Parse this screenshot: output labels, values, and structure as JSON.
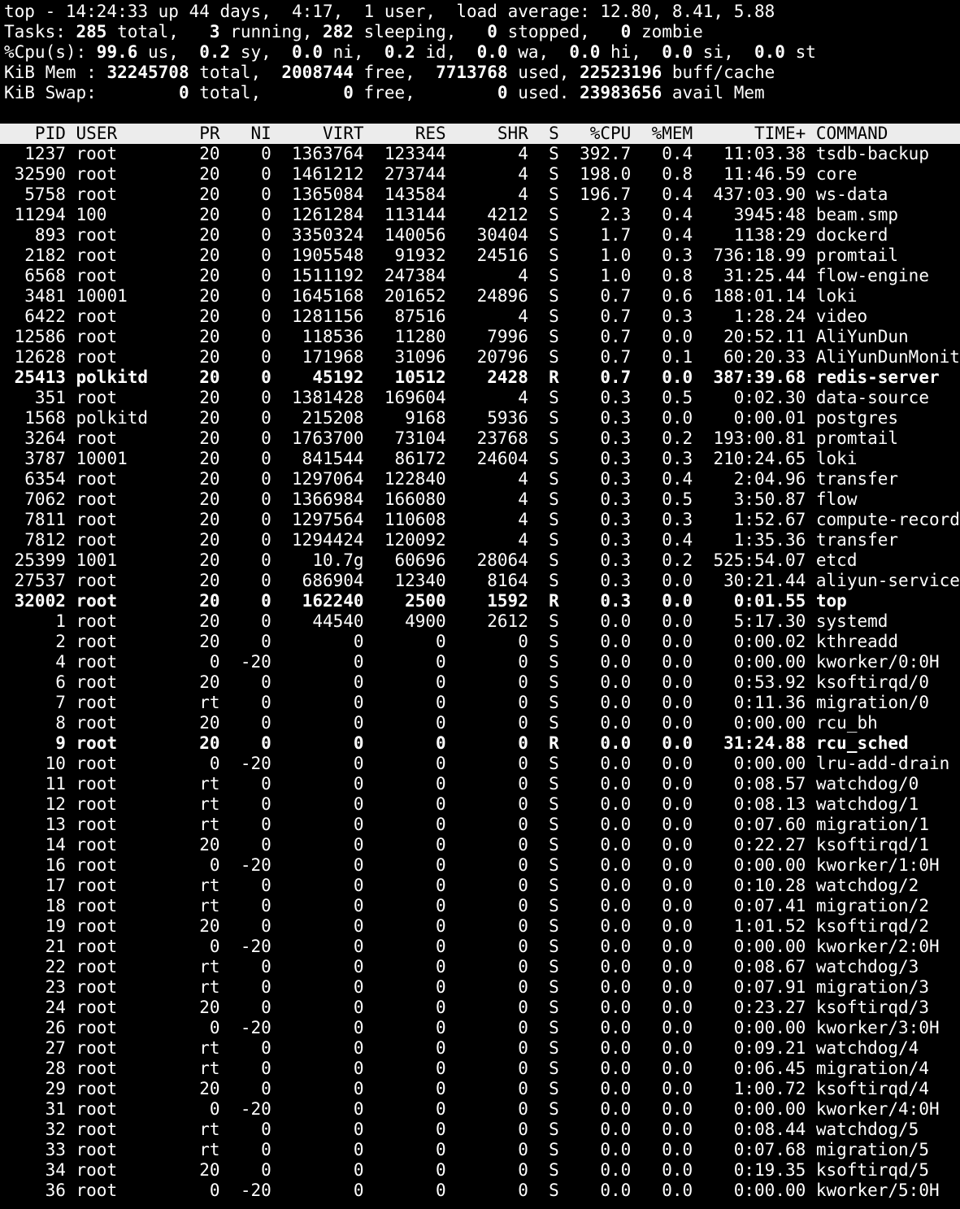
{
  "summary": {
    "top": {
      "prefix": "top - ",
      "time": "14:24:33",
      "up_label": " up ",
      "uptime": "44 days,  4:17",
      "users_sep": ",  ",
      "users": "1",
      "users_label": " user,  load average: ",
      "load": "12.80, 8.41, 5.88"
    },
    "tasks": {
      "label": "Tasks: ",
      "total": "285",
      "total_label": " total,   ",
      "running": "3",
      "running_label": " running, ",
      "sleeping": "282",
      "sleeping_label": " sleeping,   ",
      "stopped": "0",
      "stopped_label": " stopped,   ",
      "zombie": "0",
      "zombie_label": " zombie"
    },
    "cpu": {
      "label": "%Cpu(s): ",
      "us": "99.6",
      "us_label": " us,  ",
      "sy": "0.2",
      "sy_label": " sy,  ",
      "ni": "0.0",
      "ni_label": " ni,  ",
      "id": "0.2",
      "id_label": " id,  ",
      "wa": "0.0",
      "wa_label": " wa,  ",
      "hi": "0.0",
      "hi_label": " hi,  ",
      "si": "0.0",
      "si_label": " si,  ",
      "st": "0.0",
      "st_label": " st"
    },
    "mem": {
      "label": "KiB Mem : ",
      "total": "32245708",
      "total_label": " total,  ",
      "free": "2008744",
      "free_label": " free,  ",
      "used": "7713768",
      "used_label": " used, ",
      "buff": "22523196",
      "buff_label": " buff/cache"
    },
    "swap": {
      "label": "KiB Swap:        ",
      "total": "0",
      "total_label": " total,        ",
      "free": "0",
      "free_label": " free,        ",
      "used": "0",
      "used_label": " used. ",
      "avail": "23983656",
      "avail_label": " avail Mem"
    }
  },
  "columns": [
    {
      "key": "pid",
      "label": "PID",
      "width": 6,
      "align": "right"
    },
    {
      "key": "user",
      "label": "USER",
      "width": 9,
      "align": "left"
    },
    {
      "key": "pr",
      "label": "PR",
      "width": 4,
      "align": "right"
    },
    {
      "key": "ni",
      "label": "NI",
      "width": 4,
      "align": "right"
    },
    {
      "key": "virt",
      "label": "VIRT",
      "width": 8,
      "align": "right"
    },
    {
      "key": "res",
      "label": "RES",
      "width": 7,
      "align": "right"
    },
    {
      "key": "shr",
      "label": "SHR",
      "width": 7,
      "align": "right"
    },
    {
      "key": "s",
      "label": "S",
      "width": 2,
      "align": "right"
    },
    {
      "key": "cpu",
      "label": "%CPU",
      "width": 6,
      "align": "right"
    },
    {
      "key": "mem",
      "label": "%MEM",
      "width": 5,
      "align": "right"
    },
    {
      "key": "time",
      "label": "TIME+",
      "width": 10,
      "align": "right"
    },
    {
      "key": "command",
      "label": "COMMAND",
      "width": 0,
      "align": "left"
    }
  ],
  "processes": [
    [
      "1237",
      "root",
      "20",
      "0",
      "1363764",
      "123344",
      "4",
      "S",
      "392.7",
      "0.4",
      "11:03.38",
      "tsdb-backup"
    ],
    [
      "32590",
      "root",
      "20",
      "0",
      "1461212",
      "273744",
      "4",
      "S",
      "198.0",
      "0.8",
      "11:46.59",
      "core"
    ],
    [
      "5758",
      "root",
      "20",
      "0",
      "1365084",
      "143584",
      "4",
      "S",
      "196.7",
      "0.4",
      "437:03.90",
      "ws-data"
    ],
    [
      "11294",
      "100",
      "20",
      "0",
      "1261284",
      "113144",
      "4212",
      "S",
      "2.3",
      "0.4",
      "3945:48",
      "beam.smp"
    ],
    [
      "893",
      "root",
      "20",
      "0",
      "3350324",
      "140056",
      "30404",
      "S",
      "1.7",
      "0.4",
      "1138:29",
      "dockerd"
    ],
    [
      "2182",
      "root",
      "20",
      "0",
      "1905548",
      "91932",
      "24516",
      "S",
      "1.0",
      "0.3",
      "736:18.99",
      "promtail"
    ],
    [
      "6568",
      "root",
      "20",
      "0",
      "1511192",
      "247384",
      "4",
      "S",
      "1.0",
      "0.8",
      "31:25.44",
      "flow-engine"
    ],
    [
      "3481",
      "10001",
      "20",
      "0",
      "1645168",
      "201652",
      "24896",
      "S",
      "0.7",
      "0.6",
      "188:01.14",
      "loki"
    ],
    [
      "6422",
      "root",
      "20",
      "0",
      "1281156",
      "87516",
      "4",
      "S",
      "0.7",
      "0.3",
      "1:28.24",
      "video"
    ],
    [
      "12586",
      "root",
      "20",
      "0",
      "118536",
      "11280",
      "7996",
      "S",
      "0.7",
      "0.0",
      "20:52.11",
      "AliYunDun"
    ],
    [
      "12628",
      "root",
      "20",
      "0",
      "171968",
      "31096",
      "20796",
      "S",
      "0.7",
      "0.1",
      "60:20.33",
      "AliYunDunMonito"
    ],
    [
      "25413",
      "polkitd",
      "20",
      "0",
      "45192",
      "10512",
      "2428",
      "R",
      "0.7",
      "0.0",
      "387:39.68",
      "redis-server"
    ],
    [
      "351",
      "root",
      "20",
      "0",
      "1381428",
      "169604",
      "4",
      "S",
      "0.3",
      "0.5",
      "0:02.30",
      "data-source"
    ],
    [
      "1568",
      "polkitd",
      "20",
      "0",
      "215208",
      "9168",
      "5936",
      "S",
      "0.3",
      "0.0",
      "0:00.01",
      "postgres"
    ],
    [
      "3264",
      "root",
      "20",
      "0",
      "1763700",
      "73104",
      "23768",
      "S",
      "0.3",
      "0.2",
      "193:00.81",
      "promtail"
    ],
    [
      "3787",
      "10001",
      "20",
      "0",
      "841544",
      "86172",
      "24604",
      "S",
      "0.3",
      "0.3",
      "210:24.65",
      "loki"
    ],
    [
      "6354",
      "root",
      "20",
      "0",
      "1297064",
      "122840",
      "4",
      "S",
      "0.3",
      "0.4",
      "2:04.96",
      "transfer"
    ],
    [
      "7062",
      "root",
      "20",
      "0",
      "1366984",
      "166080",
      "4",
      "S",
      "0.3",
      "0.5",
      "3:50.87",
      "flow"
    ],
    [
      "7811",
      "root",
      "20",
      "0",
      "1297564",
      "110608",
      "4",
      "S",
      "0.3",
      "0.3",
      "1:52.67",
      "compute-record"
    ],
    [
      "7812",
      "root",
      "20",
      "0",
      "1294424",
      "120092",
      "4",
      "S",
      "0.3",
      "0.4",
      "1:35.36",
      "transfer"
    ],
    [
      "25399",
      "1001",
      "20",
      "0",
      "10.7g",
      "60696",
      "28064",
      "S",
      "0.3",
      "0.2",
      "525:54.07",
      "etcd"
    ],
    [
      "27537",
      "root",
      "20",
      "0",
      "686904",
      "12340",
      "8164",
      "S",
      "0.3",
      "0.0",
      "30:21.44",
      "aliyun-service"
    ],
    [
      "32002",
      "root",
      "20",
      "0",
      "162240",
      "2500",
      "1592",
      "R",
      "0.3",
      "0.0",
      "0:01.55",
      "top"
    ],
    [
      "1",
      "root",
      "20",
      "0",
      "44540",
      "4900",
      "2612",
      "S",
      "0.0",
      "0.0",
      "5:17.30",
      "systemd"
    ],
    [
      "2",
      "root",
      "20",
      "0",
      "0",
      "0",
      "0",
      "S",
      "0.0",
      "0.0",
      "0:00.02",
      "kthreadd"
    ],
    [
      "4",
      "root",
      "0",
      "-20",
      "0",
      "0",
      "0",
      "S",
      "0.0",
      "0.0",
      "0:00.00",
      "kworker/0:0H"
    ],
    [
      "6",
      "root",
      "20",
      "0",
      "0",
      "0",
      "0",
      "S",
      "0.0",
      "0.0",
      "0:53.92",
      "ksoftirqd/0"
    ],
    [
      "7",
      "root",
      "rt",
      "0",
      "0",
      "0",
      "0",
      "S",
      "0.0",
      "0.0",
      "0:11.36",
      "migration/0"
    ],
    [
      "8",
      "root",
      "20",
      "0",
      "0",
      "0",
      "0",
      "S",
      "0.0",
      "0.0",
      "0:00.00",
      "rcu_bh"
    ],
    [
      "9",
      "root",
      "20",
      "0",
      "0",
      "0",
      "0",
      "R",
      "0.0",
      "0.0",
      "31:24.88",
      "rcu_sched"
    ],
    [
      "10",
      "root",
      "0",
      "-20",
      "0",
      "0",
      "0",
      "S",
      "0.0",
      "0.0",
      "0:00.00",
      "lru-add-drain"
    ],
    [
      "11",
      "root",
      "rt",
      "0",
      "0",
      "0",
      "0",
      "S",
      "0.0",
      "0.0",
      "0:08.57",
      "watchdog/0"
    ],
    [
      "12",
      "root",
      "rt",
      "0",
      "0",
      "0",
      "0",
      "S",
      "0.0",
      "0.0",
      "0:08.13",
      "watchdog/1"
    ],
    [
      "13",
      "root",
      "rt",
      "0",
      "0",
      "0",
      "0",
      "S",
      "0.0",
      "0.0",
      "0:07.60",
      "migration/1"
    ],
    [
      "14",
      "root",
      "20",
      "0",
      "0",
      "0",
      "0",
      "S",
      "0.0",
      "0.0",
      "0:22.27",
      "ksoftirqd/1"
    ],
    [
      "16",
      "root",
      "0",
      "-20",
      "0",
      "0",
      "0",
      "S",
      "0.0",
      "0.0",
      "0:00.00",
      "kworker/1:0H"
    ],
    [
      "17",
      "root",
      "rt",
      "0",
      "0",
      "0",
      "0",
      "S",
      "0.0",
      "0.0",
      "0:10.28",
      "watchdog/2"
    ],
    [
      "18",
      "root",
      "rt",
      "0",
      "0",
      "0",
      "0",
      "S",
      "0.0",
      "0.0",
      "0:07.41",
      "migration/2"
    ],
    [
      "19",
      "root",
      "20",
      "0",
      "0",
      "0",
      "0",
      "S",
      "0.0",
      "0.0",
      "1:01.52",
      "ksoftirqd/2"
    ],
    [
      "21",
      "root",
      "0",
      "-20",
      "0",
      "0",
      "0",
      "S",
      "0.0",
      "0.0",
      "0:00.00",
      "kworker/2:0H"
    ],
    [
      "22",
      "root",
      "rt",
      "0",
      "0",
      "0",
      "0",
      "S",
      "0.0",
      "0.0",
      "0:08.67",
      "watchdog/3"
    ],
    [
      "23",
      "root",
      "rt",
      "0",
      "0",
      "0",
      "0",
      "S",
      "0.0",
      "0.0",
      "0:07.91",
      "migration/3"
    ],
    [
      "24",
      "root",
      "20",
      "0",
      "0",
      "0",
      "0",
      "S",
      "0.0",
      "0.0",
      "0:23.27",
      "ksoftirqd/3"
    ],
    [
      "26",
      "root",
      "0",
      "-20",
      "0",
      "0",
      "0",
      "S",
      "0.0",
      "0.0",
      "0:00.00",
      "kworker/3:0H"
    ],
    [
      "27",
      "root",
      "rt",
      "0",
      "0",
      "0",
      "0",
      "S",
      "0.0",
      "0.0",
      "0:09.21",
      "watchdog/4"
    ],
    [
      "28",
      "root",
      "rt",
      "0",
      "0",
      "0",
      "0",
      "S",
      "0.0",
      "0.0",
      "0:06.45",
      "migration/4"
    ],
    [
      "29",
      "root",
      "20",
      "0",
      "0",
      "0",
      "0",
      "S",
      "0.0",
      "0.0",
      "1:00.72",
      "ksoftirqd/4"
    ],
    [
      "31",
      "root",
      "0",
      "-20",
      "0",
      "0",
      "0",
      "S",
      "0.0",
      "0.0",
      "0:00.00",
      "kworker/4:0H"
    ],
    [
      "32",
      "root",
      "rt",
      "0",
      "0",
      "0",
      "0",
      "S",
      "0.0",
      "0.0",
      "0:08.44",
      "watchdog/5"
    ],
    [
      "33",
      "root",
      "rt",
      "0",
      "0",
      "0",
      "0",
      "S",
      "0.0",
      "0.0",
      "0:07.68",
      "migration/5"
    ],
    [
      "34",
      "root",
      "20",
      "0",
      "0",
      "0",
      "0",
      "S",
      "0.0",
      "0.0",
      "0:19.35",
      "ksoftirqd/5"
    ],
    [
      "36",
      "root",
      "0",
      "-20",
      "0",
      "0",
      "0",
      "S",
      "0.0",
      "0.0",
      "0:00.00",
      "kworker/5:0H"
    ]
  ],
  "colors": {
    "background": "#000000",
    "text": "#ffffff",
    "header_bg": "#ececec",
    "header_text": "#000000"
  }
}
